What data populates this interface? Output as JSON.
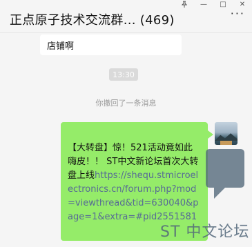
{
  "window": {
    "pin_icon": "pin-icon",
    "minimize_glyph": "—",
    "maximize_glyph": "□",
    "close_glyph": "✕"
  },
  "header": {
    "title": "正点原子技术交流群... (469)",
    "more_glyph": "···"
  },
  "chat": {
    "prev_message": "店铺啊",
    "timestamp": "13:30",
    "recall_note": "你撤回了一条消息",
    "message": {
      "prefix": "【大转盘】惊！521活动竟如此嗨皮！！ ST中文新论坛首次大转盘上线",
      "link": "https://shequ.stmicroelectronics.cn/forum.php?mod=viewthread&tid=630040&page=1&extra=#pid2551581"
    }
  },
  "watermark": {
    "text": "ST 中文论坛",
    "color": "#52677a"
  },
  "colors": {
    "bubble_green": "#95ec69",
    "link": "#576b95",
    "background": "#f5f5f5"
  }
}
